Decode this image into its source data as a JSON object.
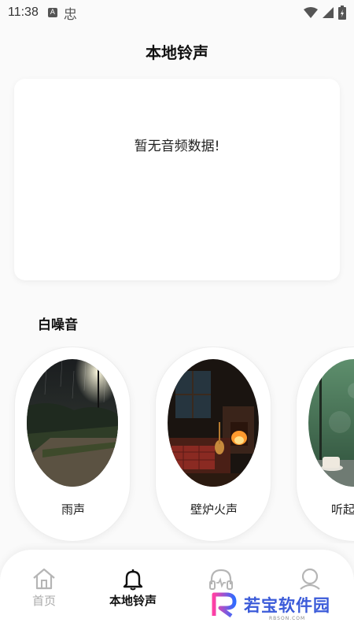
{
  "status_bar": {
    "time": "11:38",
    "icons": [
      "a-badge-icon",
      "chinese-input-icon",
      "wifi-icon",
      "signal-icon",
      "battery-icon"
    ],
    "input_char": "忠"
  },
  "header": {
    "title": "本地铃声"
  },
  "empty_state": {
    "message": "暂无音频数据!"
  },
  "white_noise": {
    "title": "白噪音",
    "items": [
      {
        "label": "雨声",
        "thumbnail": "rainy-night-park"
      },
      {
        "label": "壁炉火声",
        "thumbnail": "fireplace-room"
      },
      {
        "label": "听起来放",
        "thumbnail": "rainy-window-tea"
      }
    ]
  },
  "bottom_nav": {
    "items": [
      {
        "label": "首页",
        "icon": "home-icon",
        "active": false
      },
      {
        "label": "本地铃声",
        "icon": "bell-icon",
        "active": true
      },
      {
        "label": "",
        "icon": "headphones-icon",
        "active": false
      },
      {
        "label": "",
        "icon": "user-icon",
        "active": false
      }
    ]
  },
  "watermark": {
    "text": "若宝软件园",
    "sub": "RBSON.COM"
  },
  "colors": {
    "accent": "#111111",
    "inactive": "#aaaaaa",
    "watermark_blue": "#3b5bd9"
  }
}
